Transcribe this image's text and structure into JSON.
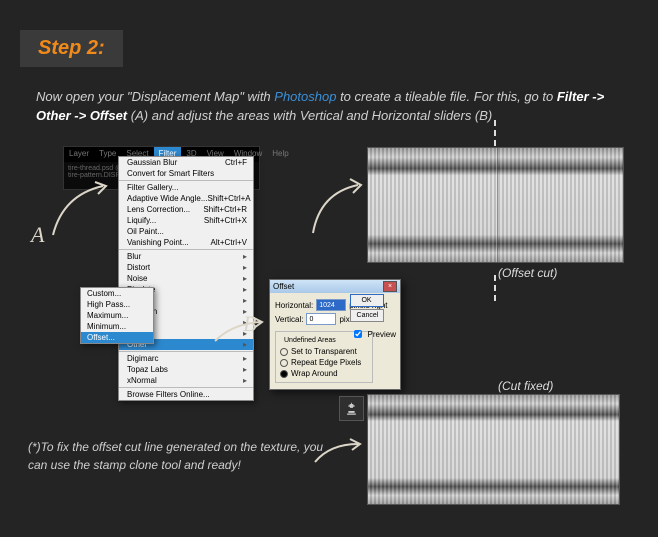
{
  "step_label": "Step 2:",
  "intro": {
    "t1": "Now open your \"Displacement Map\" with ",
    "app": "Photoshop",
    "t2": " to create a tileable file. For this, go to ",
    "path": "Filter -> Other -> Offset",
    "t3": " (A) and adjust the areas with Vertical and Horizontal sliders (B)"
  },
  "menubar": [
    "Layer",
    "Type",
    "Select",
    "Filter",
    "3D",
    "View",
    "Window",
    "Help"
  ],
  "menubar_active_index": 3,
  "docbar_lines": [
    "tire-thread.psd @...",
    "tire-pattern.DISPLA..."
  ],
  "dropdown": [
    {
      "label": "Gaussian Blur",
      "sc": "Ctrl+F"
    },
    {
      "label": "Convert for Smart Filters"
    },
    {
      "sep": true
    },
    {
      "label": "Filter Gallery..."
    },
    {
      "label": "Adaptive Wide Angle...",
      "sc": "Shift+Ctrl+A"
    },
    {
      "label": "Lens Correction...",
      "sc": "Shift+Ctrl+R"
    },
    {
      "label": "Liquify...",
      "sc": "Shift+Ctrl+X"
    },
    {
      "label": "Oil Paint..."
    },
    {
      "label": "Vanishing Point...",
      "sc": "Alt+Ctrl+V"
    },
    {
      "sep": true
    },
    {
      "label": "Blur",
      "sub": true
    },
    {
      "label": "Distort",
      "sub": true
    },
    {
      "label": "Noise",
      "sub": true
    },
    {
      "label": "Pixelate",
      "sub": true
    },
    {
      "label": "Render",
      "sub": true
    },
    {
      "label": "Sharpen",
      "sub": true
    },
    {
      "label": "Stylize",
      "sub": true
    },
    {
      "label": "Video",
      "sub": true
    },
    {
      "label": "Other",
      "sub": true,
      "hi": true
    },
    {
      "sep": true
    },
    {
      "label": "Digimarc",
      "sub": true
    },
    {
      "label": "Topaz Labs",
      "sub": true
    },
    {
      "label": "xNormal",
      "sub": true
    },
    {
      "sep": true
    },
    {
      "label": "Browse Filters Online..."
    }
  ],
  "submenu": [
    {
      "label": "Custom..."
    },
    {
      "label": "High Pass..."
    },
    {
      "label": "Maximum..."
    },
    {
      "label": "Minimum..."
    },
    {
      "label": "Offset...",
      "hi": true
    }
  ],
  "offset_dialog": {
    "title": "Offset",
    "h_label": "Horizontal:",
    "h_val": "1024",
    "h_unit": "pixels right",
    "v_label": "Vertical:",
    "v_val": "0",
    "v_unit": "pixels down",
    "ok": "OK",
    "cancel": "Cancel",
    "preview": "Preview",
    "group": "Undefined Areas",
    "r1": "Set to Transparent",
    "r2": "Repeat Edge Pixels",
    "r3": "Wrap Around"
  },
  "captions": {
    "offset_cut": "(Offset cut)",
    "cut_fixed": "(Cut fixed)"
  },
  "labelA": "A",
  "labelB": "B",
  "note": "(*)To fix the offset cut line generated on the texture, you can use the stamp clone tool and ready!"
}
